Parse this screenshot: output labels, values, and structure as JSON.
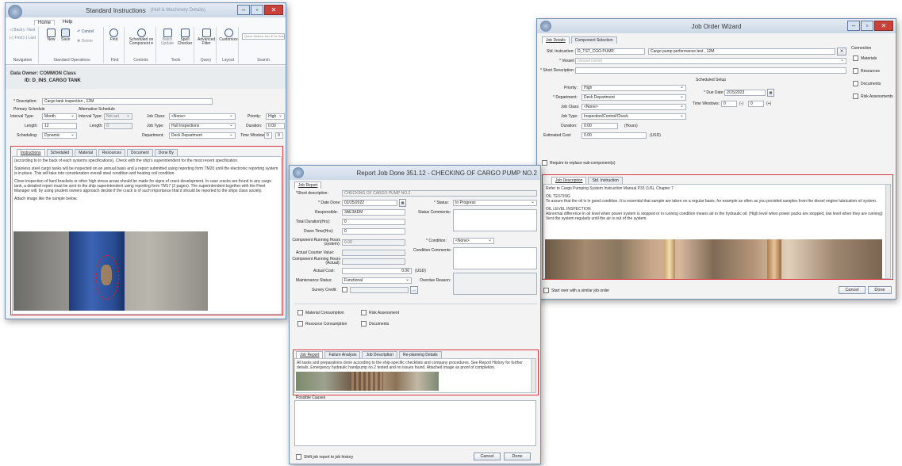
{
  "standard": {
    "title": "Standard Instructions",
    "title_suffix": "(Hull & Machinery Details)",
    "menu_tabs": [
      "Home",
      "Help"
    ],
    "ribbon": {
      "nav": {
        "back": "◁ Back",
        "next": "▷ Next",
        "first": "|◁ First",
        "last": "▷| Last",
        "group": "Navigation"
      },
      "std_ops": {
        "new": "New",
        "save": "Save",
        "cancel": "↶ Cancel",
        "delete": "✖ Delete",
        "group": "Standard Operations"
      },
      "find": {
        "label": "Find",
        "group": "Find"
      },
      "controls": {
        "label": "Scheduled on Component ▾",
        "group": "Controls"
      },
      "tools": {
        "batch": "Batch Update",
        "spell": "Spell Checker",
        "group": "Tools"
      },
      "query": {
        "label": "Advanced Filter",
        "group": "Query"
      },
      "layout": {
        "label": "Customize",
        "group": "Layout"
      },
      "search": {
        "placeholder": "Quick Search Job ID or Description",
        "group": "Search"
      }
    },
    "data_owner": "Data Owner: COMMON Class",
    "id": "ID: D_INS_CARGO TANK",
    "description_label": "* Description:",
    "description_value": "Cargo tank inspection , 12M",
    "primary_schedule": "Primary Schedule",
    "alt_schedule": "Alternative Schedule",
    "interval_type_label": "Interval Type:",
    "interval_type_value": "Month",
    "alt_interval_type_value": "Not set",
    "length_label": "Length:",
    "length_value": "12",
    "alt_length_value": "0",
    "scheduling_label": "Scheduling:",
    "scheduling_value": "Dynamic",
    "job_class_label": "Job Class:",
    "job_class_value": "<None>",
    "job_type_label": "Job Type:",
    "job_type_value": "Hull Inspections",
    "department_label": "Department:",
    "department_value": "Deck Department",
    "priority_label": "Priority:",
    "priority_value": "High",
    "duration_label": "Duration:",
    "duration_value": "0.00",
    "time_windows_label": "Time Windows:",
    "time_windows_a": "0",
    "time_windows_b": "0",
    "tabs": [
      "Instructions",
      "Scheduled",
      "Material",
      "Resources",
      "Document",
      "Done By"
    ],
    "instructions": [
      "(according to in the back of each systems specifications). Check with the ship's superintendent for the most recent specification.",
      "Stainless steel cargo tanks will be inspected on an annual basis and a report submitted using reporting form TM20 until the electronic reporting system is in place. This will take into consideration overall steel condition and heating coil condition.",
      "Close inspection of hard brackets or other high stress areas should be made for signs of crack development. In case cracks are found in any cargo tank, a detailed report must be sent to the ship superintendent using reporting form TM17 (2 pages). The superintendent together with the Fleet Manager will, by using prudent owners approach decide if the crack is of such importance that it should be reported to the ships class society.",
      "Attach image like the sample below."
    ]
  },
  "wizard": {
    "title": "Job Order Wizard",
    "tabs": [
      "Job Details",
      "Component Selection"
    ],
    "std_instruction_label": "Std. Instruction:",
    "std_instruction_code": "D_TST_CGO.PUMP.",
    "std_instruction_desc": "Cargo pump performance test , 12M",
    "vessel_label": "* Vessel:",
    "vessel_value": "(vessel name)",
    "short_desc_label": "* Short Description:",
    "priority_label": "Priority:",
    "priority_value": "High",
    "department_label": "* Department:",
    "department_value": "Deck Department",
    "job_class_label": "Job Class:",
    "job_class_value": "<None>",
    "job_type_label": "Job Type:",
    "job_type_value": "Inspection/Control/Check",
    "duration_label": "Duration:",
    "duration_value": "0.00",
    "duration_unit": "(Hours)",
    "est_cost_label": "Estimated Cost:",
    "est_cost_value": "0.00",
    "est_cost_unit": "(USD)",
    "scheduled_setup": "Scheduled Setup",
    "due_date_label": "* Due Date:",
    "due_date_value": "2/15/2023",
    "time_windows_label": "Time Windows:",
    "tw_a": "0",
    "tw_b": "0",
    "connection": "Connection",
    "conn_items": [
      "Materials",
      "Resources",
      "Documents",
      "Risk Assessments"
    ],
    "require_replace": "Require to replace sub-component(s)",
    "desc_tabs": [
      "Job Description",
      "Std. Instruction"
    ],
    "desc_lines": [
      "Refer to Cargo Pumping System Instruction Manual P33 (1/6), Chapter 7",
      "OIL TESTING",
      "To assure that the oil is in good condition. It is essential that sample are taken on a regular basis, for example as often as you provided samples from the diesel engine lubrication oil system.",
      "OIL LEVEL INSPECTION",
      "Abnormal difference in oil level when power system is stopped or in running condition means air in the hydraulic oil. (High level when power packs are stopped, low level when they are running) Vent the system regularly until the air is out of the system."
    ],
    "start_over": "Start over with a similar job order",
    "cancel": "Cancel",
    "done": "Done"
  },
  "report": {
    "title": "Report Job Done 351.12 - CHECKING OF CARGO PUMP NO.2",
    "tab": "Job Report",
    "short_desc_label": "*Short description:",
    "short_desc_value": "CHECKING OF CARGO PUMP NO.2",
    "date_done_label": "* Date Done:",
    "date_done_value": "02/25/2022",
    "responsible_label": "Responsible:",
    "responsible_value": "3AE3ADM",
    "total_duration_label": "Total Duration(Hrs):",
    "total_duration_value": "0",
    "down_time_label": "Down Time(Hrs):",
    "down_time_value": "0",
    "crh_system_label": "Component Running Hours (system):",
    "crh_system_value": "0.00",
    "acv_label": "Actual Counter Value:",
    "crh_actual_label": "Component Running Hours (Actual):",
    "actual_cost_label": "Actual Cost:",
    "actual_cost_value": "0.00",
    "actual_cost_unit": "(USD)",
    "maint_status_label": "Maintenance Status:",
    "maint_status_value": "Functional",
    "survey_credit_label": "Survey Credit:",
    "status_label": "* Status:",
    "status_value": "In Progress",
    "status_comments_label": "Status Comments:",
    "condition_label": "* Condition:",
    "condition_value": "<None>",
    "condition_comments_label": "Condition Comments:",
    "overdue_reason_label": "Overdue Reason:",
    "checks": [
      "Material Consumption",
      "Risk Assessment",
      "Resource Consumption",
      "Documents"
    ],
    "bottom_tabs": [
      "Job Report",
      "Failure Analysis",
      "Job Description",
      "Re-planning Details"
    ],
    "report_text": "All tasks and preparations done according to the ship-specific checklists and company procedures. See Report History for further details. Emergency hydraulic handpump no.2 tested and no issues found. Attached image as proof of completion.",
    "possible_causes": "Possible Causes",
    "shift": "Shift job report to job history",
    "cancel": "Cancel",
    "done": "Done"
  }
}
